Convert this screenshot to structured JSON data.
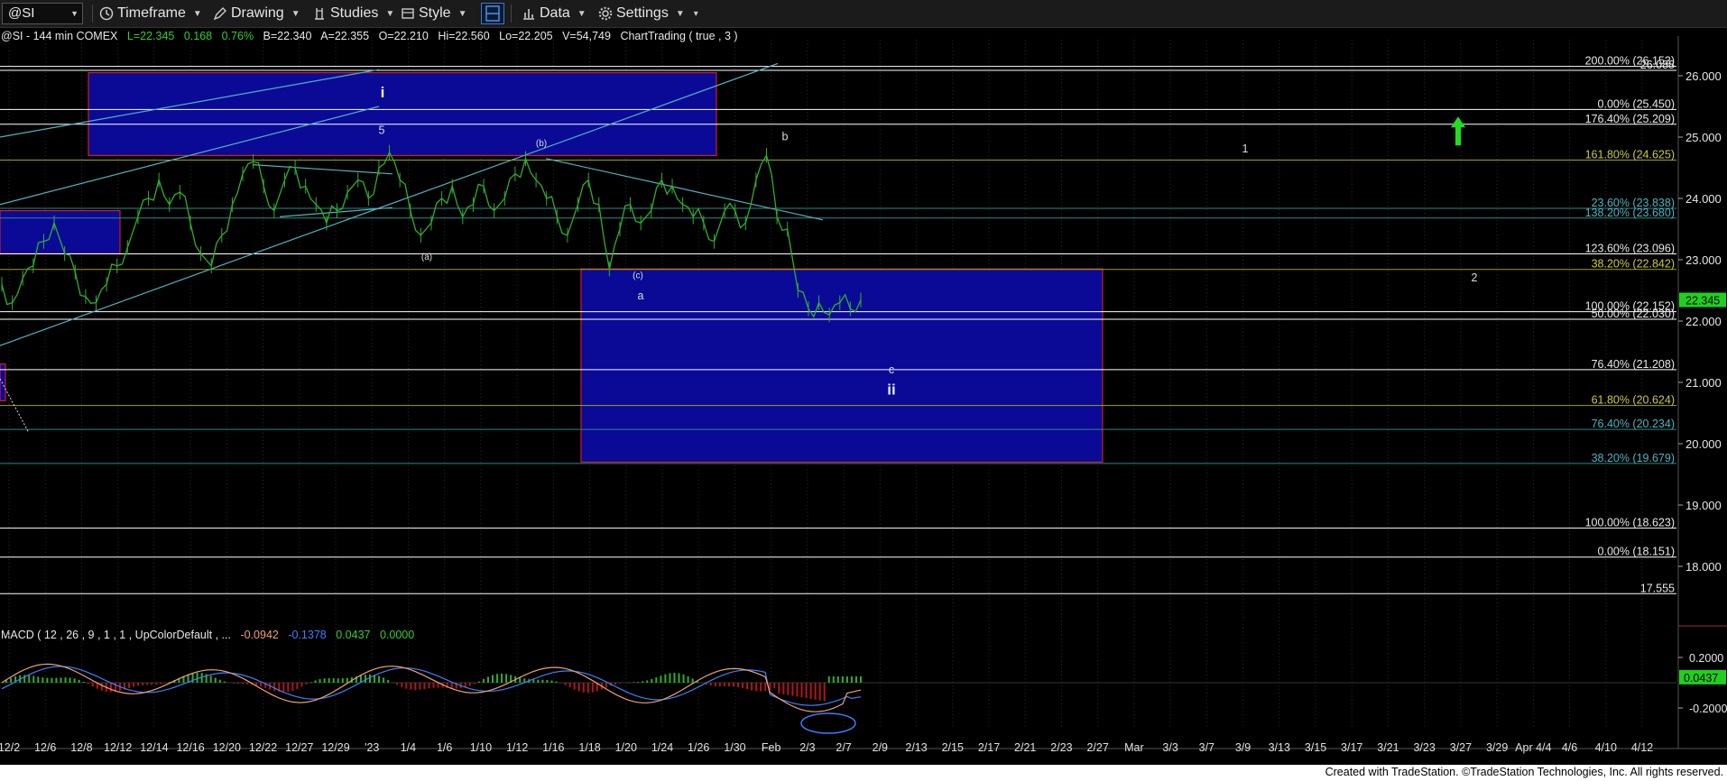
{
  "toolbar": {
    "symbol": "@SI",
    "timeframe_label": "Timeframe",
    "drawing_label": "Drawing",
    "studies_label": "Studies",
    "style_label": "Style",
    "data_label": "Data",
    "settings_label": "Settings"
  },
  "header": {
    "symbol_desc": "@SI - 144 min  COMEX",
    "last": "L=22.345",
    "change": "0.168",
    "change_pct": "0.76%",
    "bid": "B=22.340",
    "ask": "A=22.355",
    "open": "O=22.210",
    "high": "Hi=22.560",
    "low": "Lo=22.205",
    "volume": "V=54,749",
    "study": "ChartTrading ( true , 3 )"
  },
  "macd_header": {
    "name": "MACD ( 12 , 26 , 9 , 1 , 1 , UpColorDefault , ...",
    "v1": "-0.0942",
    "v2": "-0.1378",
    "v3": "0.0437",
    "v4": "0.0000"
  },
  "footer": "Created with TradeStation. ©TradeStation Technologies, Inc. All rights reserved.",
  "colors": {
    "price": "#2fae2f",
    "box_fill": "#0a0a96",
    "box_border": "#cc1f1f",
    "trendline": "#4fb3c0",
    "up_arrow": "#22dd22",
    "macd_line": "#f0a070",
    "signal_line": "#3b7fff",
    "hist_up": "#2fae2f",
    "hist_down": "#b01818"
  },
  "chart_data": {
    "type": "line",
    "instrument": "@SI",
    "interval": "144 min",
    "ylim": [
      17.2,
      26.5
    ],
    "price_ticks": [
      "26.000",
      "25.000",
      "24.000",
      "23.000",
      "22.000",
      "21.000",
      "20.000",
      "19.000",
      "18.000"
    ],
    "last_price_label": "22.345",
    "x_tick_labels": [
      "12/2",
      "12/6",
      "12/8",
      "12/12",
      "12/14",
      "12/16",
      "12/20",
      "12/22",
      "12/27",
      "12/29",
      "'23",
      "1/4",
      "1/6",
      "1/10",
      "1/12",
      "1/16",
      "1/18",
      "1/20",
      "1/24",
      "1/26",
      "1/30",
      "Feb",
      "2/3",
      "2/7",
      "2/9",
      "2/13",
      "2/15",
      "2/17",
      "2/21",
      "2/23",
      "2/27",
      "Mar",
      "3/3",
      "3/7",
      "3/9",
      "3/13",
      "3/15",
      "3/17",
      "3/21",
      "3/23",
      "3/27",
      "3/29",
      "Apr 4/4",
      "4/6",
      "4/10",
      "4/12"
    ],
    "series": [
      {
        "values": [
          22.6,
          22.3,
          22.7,
          22.9,
          23.3,
          23.6,
          23.1,
          22.8,
          22.4,
          22.3,
          22.6,
          22.9,
          23.2,
          23.7,
          24.0,
          24.3,
          23.9,
          24.1,
          23.6,
          23.1,
          22.9,
          23.4,
          23.9,
          24.4,
          24.6,
          24.2,
          23.8,
          24.3,
          24.5,
          24.2,
          23.9,
          23.6,
          23.8,
          24.1,
          24.3,
          24.0,
          24.5,
          24.75,
          24.3,
          23.8,
          23.4,
          23.6,
          24.0,
          24.2,
          23.7,
          23.9,
          24.2,
          23.8,
          24.0,
          24.4,
          24.65,
          24.3,
          24.0,
          23.7,
          23.4,
          23.9,
          24.3,
          23.9,
          22.85,
          23.5,
          23.9,
          23.6,
          23.8,
          24.3,
          24.2,
          23.9,
          23.7,
          23.6,
          23.3,
          23.8,
          23.8,
          23.6,
          24.3,
          24.7,
          23.7,
          23.5,
          22.5,
          22.2,
          22.3,
          22.1,
          22.3,
          22.2,
          22.345
        ]
      }
    ],
    "fib_levels": [
      "200.00% (26.153)",
      "26.088",
      "0.00% (25.450)",
      "176.40% (25.209)",
      "161.80% (24.625)",
      "23.60% (23.838)",
      "138.20% (23.680)",
      "123.60% (23.096)",
      "38.20% (22.842)",
      "100.00% (22.152)",
      "50.00% (22.030)",
      "76.40% (21.208)",
      "61.80% (20.624)",
      "76.40% (20.234)",
      "38.20% (19.679)",
      "100.00% (18.623)",
      "0.00% (18.151)",
      "17.555"
    ],
    "wave_labels": [
      "i",
      "5",
      "(b)",
      "b",
      "1",
      "(a)",
      "(c)",
      "a",
      "2",
      "c",
      "ii"
    ],
    "macd": {
      "ticks": [
        "0.2000",
        "-0.2000"
      ],
      "value_label": "0.0437"
    }
  }
}
